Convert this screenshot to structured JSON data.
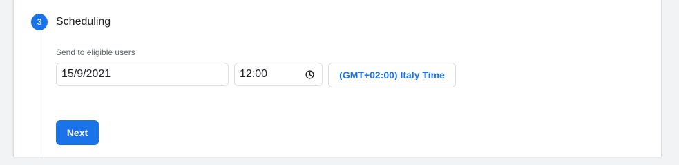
{
  "step": {
    "number": "3",
    "title": "Scheduling"
  },
  "schedule": {
    "label": "Send to eligible users",
    "date_value": "15/9/2021",
    "time_value": "12:00",
    "timezone_label": "(GMT+02:00) Italy Time"
  },
  "actions": {
    "next_label": "Next"
  },
  "colors": {
    "accent": "#1a73e8",
    "border": "#dadce0",
    "text": "#202124",
    "muted": "#5f6368"
  },
  "icons": {
    "time_picker": "clock-icon"
  }
}
